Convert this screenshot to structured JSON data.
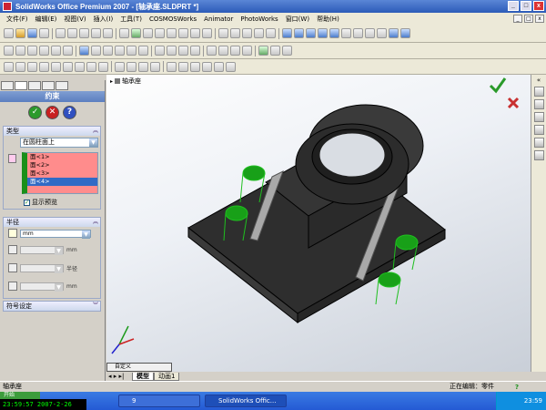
{
  "window": {
    "title": "SolidWorks Office Premium 2007 - [轴承座.SLDPRT *]"
  },
  "menu": {
    "items": [
      "文件(F)",
      "编辑(E)",
      "视图(V)",
      "插入(I)",
      "工具(T)",
      "COSMOSWorks",
      "Animator",
      "PhotoWorks",
      "窗口(W)",
      "帮助(H)"
    ]
  },
  "property_manager": {
    "title": "约束",
    "ok": "✓",
    "cancel": "✕",
    "help": "?",
    "type_group": {
      "label": "类型",
      "selected": "在圆柱面上"
    },
    "selections": [
      "面<1>",
      "面<2>",
      "面<3>",
      "面<4>"
    ],
    "selected_index": 3,
    "show_preview": "显示预览",
    "params_group": {
      "label": "半径",
      "unit_value": "mm",
      "row1_unit": "mm",
      "row2_unit": "半径",
      "row3_unit": "mm"
    },
    "symbol_group": {
      "label": "符号设定"
    }
  },
  "viewport": {
    "part_name": "轴承座",
    "custom_view": "自定义"
  },
  "bottom_tabs": [
    "模型",
    "动画1"
  ],
  "status": {
    "left": "轴承座",
    "mode": "正在编辑：零件"
  },
  "taskbar": {
    "start": "开始",
    "clock_left": "23:59:57 2007-2-26",
    "task1": "9",
    "task2": "SolidWorks Offic...",
    "tray_time": "23:59"
  },
  "colors": {
    "accent": "#2c5bb8",
    "green": "#1a8f1a",
    "select_red": "#ff8c8c"
  }
}
